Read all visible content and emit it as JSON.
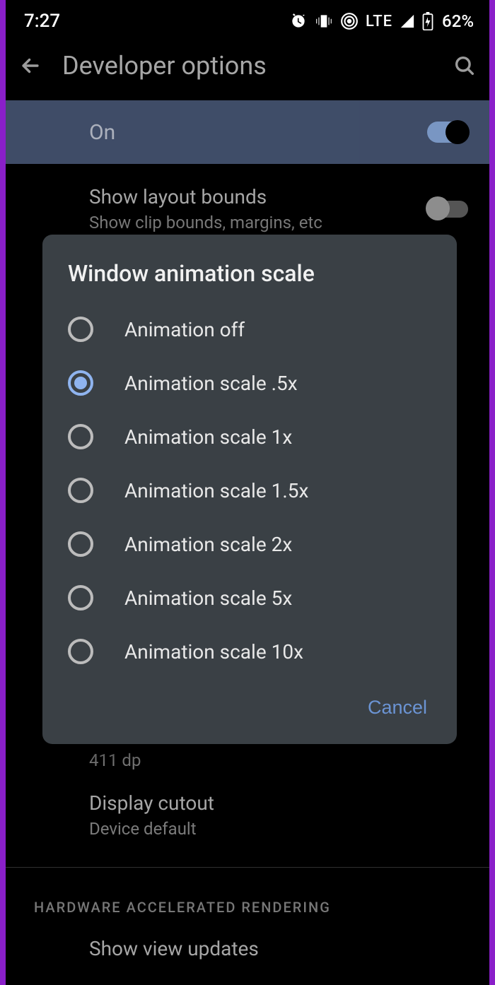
{
  "status": {
    "time": "7:27",
    "network": "LTE",
    "battery": "62%"
  },
  "appbar": {
    "title": "Developer options"
  },
  "on_panel": {
    "label": "On"
  },
  "items": {
    "layout_bounds": {
      "title": "Show layout bounds",
      "subtitle": "Show clip bounds, margins, etc"
    },
    "width_value": "411 dp",
    "cutout": {
      "title": "Display cutout",
      "subtitle": "Device default"
    },
    "view_updates": "Show view updates"
  },
  "section": {
    "hardware": "HARDWARE ACCELERATED RENDERING"
  },
  "dialog": {
    "title": "Window animation scale",
    "options": [
      {
        "label": "Animation off",
        "selected": false
      },
      {
        "label": "Animation scale .5x",
        "selected": true
      },
      {
        "label": "Animation scale 1x",
        "selected": false
      },
      {
        "label": "Animation scale 1.5x",
        "selected": false
      },
      {
        "label": "Animation scale 2x",
        "selected": false
      },
      {
        "label": "Animation scale 5x",
        "selected": false
      },
      {
        "label": "Animation scale 10x",
        "selected": false
      }
    ],
    "cancel": "Cancel"
  }
}
